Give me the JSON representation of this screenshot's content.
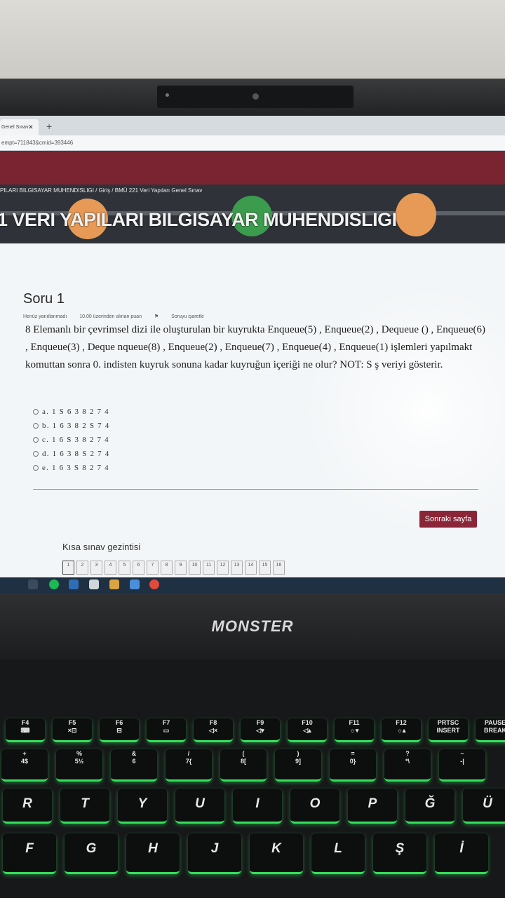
{
  "browser": {
    "tab_title": "Genel Sınav",
    "tab_close": "✕",
    "new_tab": "+",
    "url": "empt=711843&cmid=393446"
  },
  "header": {
    "breadcrumb": "PILARI BILGISAYAR MUHENDISLIGI  /  Giriş  /  BMÜ 221 Veri Yapıları Genel Sınav",
    "course_title": "1 VERI YAPILARI BILGISAYAR MUHENDISLIGI"
  },
  "question": {
    "heading": "Soru 1",
    "status": "Henüz yanıtlanmadı",
    "points": "10.00 üzerinden alınan puan",
    "flag": "Soruyu işaretle",
    "text": "8 Elemanlı bir çevrimsel dizi ile oluşturulan bir kuyrukta Enqueue(5) , Enqueue(2) , Dequeue () , Enqueue(6) , Enqueue(3) , Deque          nqueue(8) , Enqueue(2) , Enqueue(7) , Enqueue(4) , Enqueue(1) işlemleri yapılmakt           komuttan sonra 0. indisten kuyruk sonuna kadar kuyruğun içeriği ne olur? NOT: S          ş veriyi gösterir.",
    "options": [
      "a. 1 S 6 3 8 2 7 4",
      "b. 1 6 3 8 2 S 7 4",
      "c. 1 6 S 3 8 2 7 4",
      "d. 1 6 3 8 S 2 7 4",
      "e. 1 6 3 S 8 2 7 4"
    ]
  },
  "actions": {
    "next_page": "Sonraki sayfa"
  },
  "navigation": {
    "title": "Kısa sınav gezintisi",
    "pages": [
      "1",
      "2",
      "3",
      "4",
      "5",
      "6",
      "7",
      "8",
      "9",
      "10",
      "11",
      "12",
      "13",
      "14",
      "15",
      "16"
    ]
  },
  "laptop": {
    "brand": "MONSTER",
    "fn_keys": [
      {
        "top": "F4",
        "bot": "⌨"
      },
      {
        "top": "F5",
        "bot": "×⊡"
      },
      {
        "top": "F6",
        "bot": "⊟"
      },
      {
        "top": "F7",
        "bot": "▭"
      },
      {
        "top": "F8",
        "bot": "◁×"
      },
      {
        "top": "F9",
        "bot": "◁▾"
      },
      {
        "top": "F10",
        "bot": "◁▴"
      },
      {
        "top": "F11",
        "bot": "☼▾"
      },
      {
        "top": "F12",
        "bot": "☼▴"
      },
      {
        "top": "PRTSC",
        "bot": "INSERT"
      },
      {
        "top": "PAUSE",
        "bot": "BREAK"
      }
    ],
    "num_keys": [
      {
        "top": "+",
        "bot": "4$"
      },
      {
        "top": "%",
        "bot": "5½"
      },
      {
        "top": "&",
        "bot": "6"
      },
      {
        "top": "/",
        "bot": "7{"
      },
      {
        "top": "(",
        "bot": "8["
      },
      {
        "top": ")",
        "bot": "9]"
      },
      {
        "top": "=",
        "bot": "0}"
      },
      {
        "top": "?",
        "bot": "*\\"
      },
      {
        "top": "–",
        "bot": "-|"
      }
    ],
    "row_keys": [
      "R",
      "T",
      "Y",
      "U",
      "I",
      "O",
      "P",
      "Ğ",
      "Ü"
    ],
    "home_keys": [
      "F",
      "G",
      "H",
      "J",
      "K",
      "L",
      "Ş",
      "İ"
    ]
  }
}
